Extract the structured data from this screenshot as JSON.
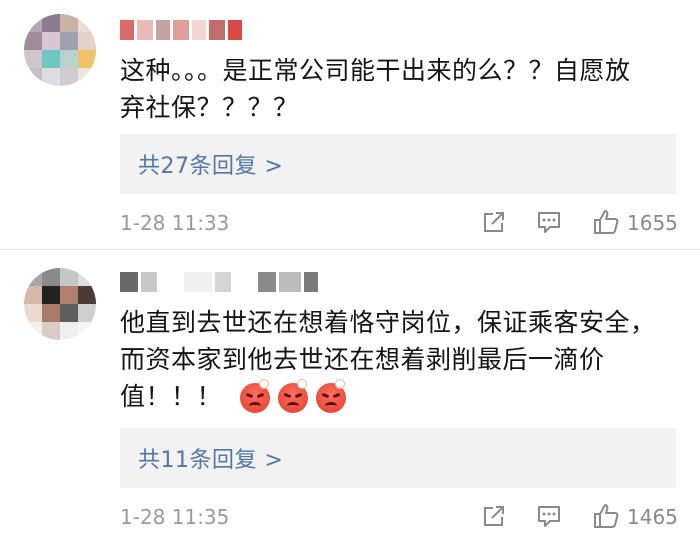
{
  "comments": [
    {
      "text_lines": [
        "这种。。。是正常公司能干出来的么？？自愿放",
        "弃社保？？？？"
      ],
      "reply_label": "共27条回复 >",
      "time": "1-28 11:33",
      "likes": "1655",
      "avatar_colors": [
        "#b7a7b5",
        "#8d7a8d",
        "#c8b2a8",
        "#e6ddd7",
        "#9f8b9b",
        "#d5c7d6",
        "#a0a0ad",
        "#e2d2c9",
        "#d1c4cb",
        "#6fc7c1",
        "#b7d2d0",
        "#f2c267",
        "#c4c0c8",
        "#dedbe3",
        "#d2cbd1",
        "#ebe4e3"
      ],
      "username_colors": [
        "#d96b66",
        "#e8b9b5",
        "#c4a1a2",
        "#e19f9b",
        "#f1d6d3",
        "#c26d6b",
        "#d74b45"
      ]
    },
    {
      "text_lines": [
        "他直到去世还在想着恪守岗位，保证乘客安全，",
        "而资本家到他去世还在想着剥削最后一滴价",
        "值！！！"
      ],
      "emoji_icons": [
        "angry-face-icon",
        "angry-face-icon",
        "angry-face-icon"
      ],
      "reply_label": "共11条回复 >",
      "time": "1-28 11:35",
      "likes": "1465",
      "avatar_colors": [
        "#a6a6a6",
        "#8a8a8a",
        "#c6c6c6",
        "#dedede",
        "#d6b8a8",
        "#222222",
        "#b08070",
        "#4a3a3a",
        "#eadcd2",
        "#a87a68",
        "#5e5e5e",
        "#cfcfcf",
        "#f3efec",
        "#d8ccc4",
        "#efefef",
        "#f7f7f7"
      ],
      "username_colors": [
        "#6a6a6a",
        "#c8c8c8",
        "#f0f0f0",
        "#d4d4d4",
        "#8a8a8a",
        "#bcbcbc",
        "#7a7a7a"
      ]
    }
  ],
  "colors": {
    "link": "#5277a6",
    "reply_bg": "#f2f2f2",
    "meta_text": "#9a9a9a",
    "divider": "#e6e6e6"
  }
}
